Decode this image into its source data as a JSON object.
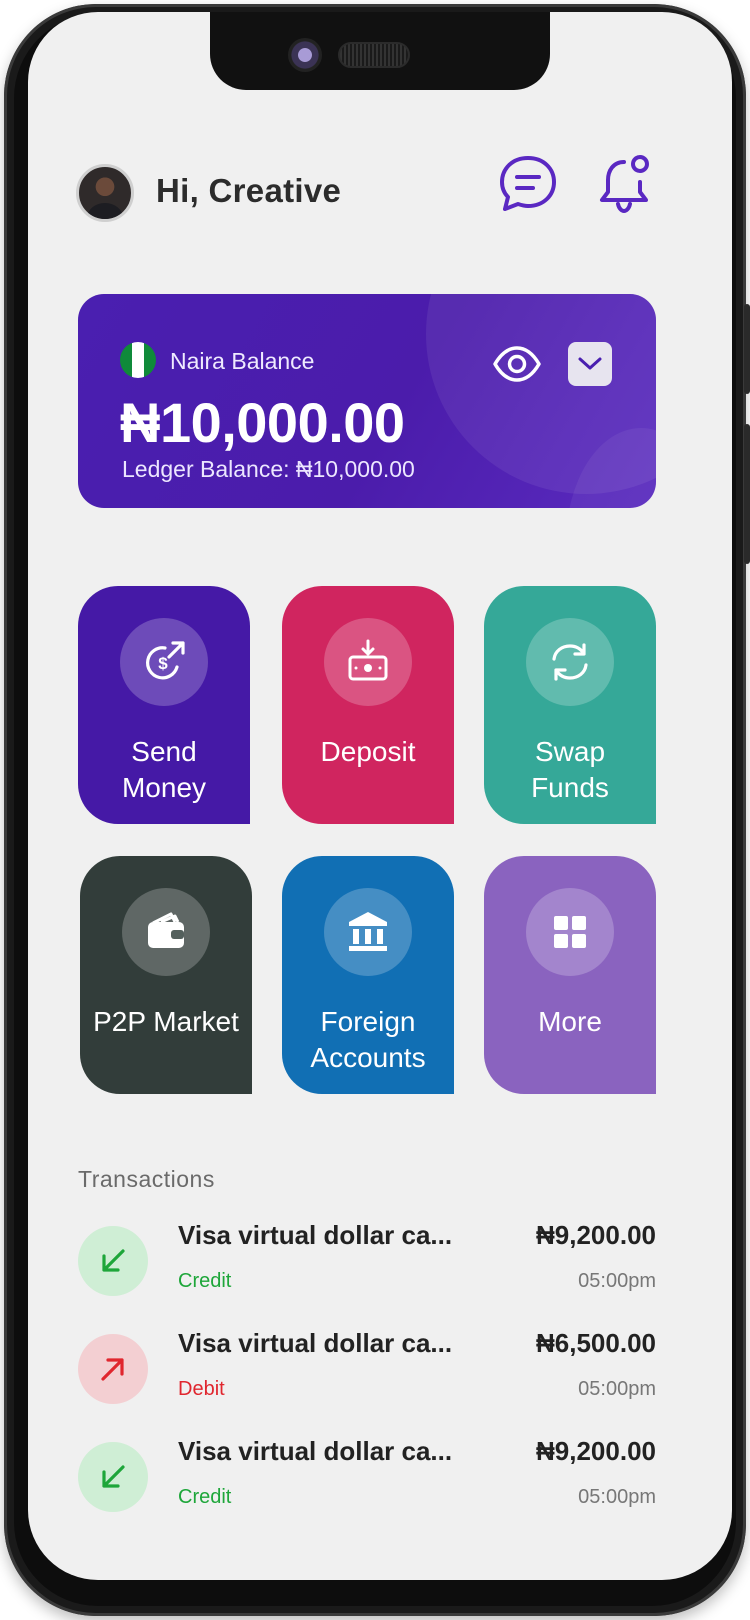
{
  "header": {
    "greeting": "Hi, Creative"
  },
  "balance": {
    "label": "Naira Balance",
    "amount": "₦10,000.00",
    "ledger": "Ledger Balance: ₦10,000.00",
    "flag_colors": [
      "#0f8a3a",
      "#ffffff",
      "#0f8a3a"
    ]
  },
  "actions": [
    {
      "label": "Send\nMoney",
      "icon": "send-money-icon",
      "color": "#4519a6"
    },
    {
      "label": "Deposit",
      "icon": "deposit-icon",
      "color": "#d0255f"
    },
    {
      "label": "Swap\nFunds",
      "icon": "swap-icon",
      "color": "#35a898"
    },
    {
      "label": "P2P Market",
      "icon": "wallet-icon",
      "color": "#323d3a"
    },
    {
      "label": "Foreign\nAccounts",
      "icon": "bank-icon",
      "color": "#116fb4"
    },
    {
      "label": "More",
      "icon": "grid-icon",
      "color": "#8a63bf"
    }
  ],
  "transactions": {
    "title": "Transactions",
    "items": [
      {
        "name": "Visa virtual dollar ca...",
        "type": "Credit",
        "amount": "₦9,200.00",
        "time": "05:00pm"
      },
      {
        "name": "Visa virtual dollar ca...",
        "type": "Debit",
        "amount": "₦6,500.00",
        "time": "05:00pm"
      },
      {
        "name": "Visa virtual dollar ca...",
        "type": "Credit",
        "amount": "₦9,200.00",
        "time": "05:00pm"
      }
    ]
  },
  "colors": {
    "brand_purple": "#4a1fb0",
    "credit_green": "#1ea63a",
    "debit_red": "#e0262e"
  }
}
